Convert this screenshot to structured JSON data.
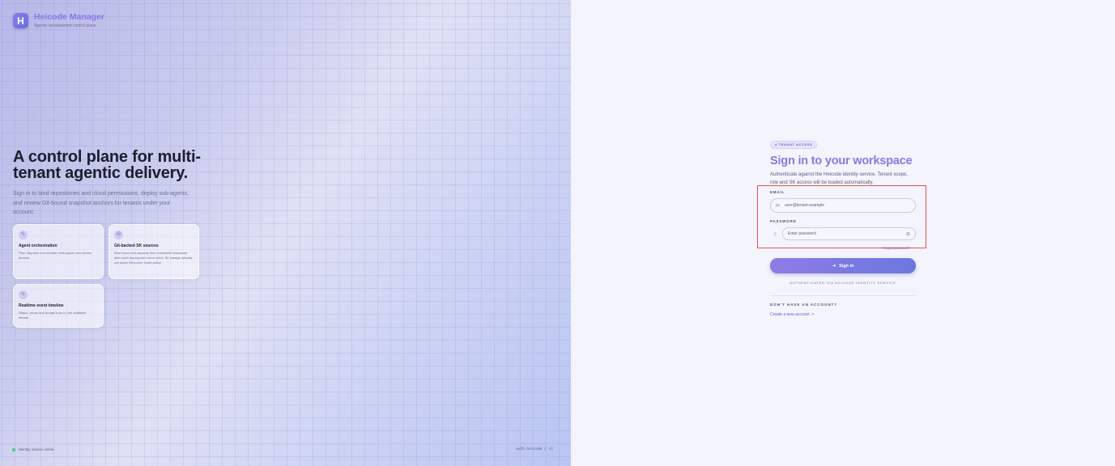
{
  "brand": {
    "logo_letter": "H",
    "name": "Heicode Manager",
    "tagline": "Agentic development control plane"
  },
  "hero": {
    "title": "A control plane for multi-tenant agentic delivery.",
    "description": "Sign in to bind repositories and cloud permissions, deploy sub-agents, and review Git-bound snapshot anchors for tenants under your account."
  },
  "features": [
    {
      "icon": "link-icon",
      "glyph": "✎",
      "title": "Agent orchestration",
      "description": "Plan, dispatch and monitor multi-agent runs across tenants."
    },
    {
      "icon": "database-icon",
      "glyph": "⛁",
      "title": "Git-backed SK sources",
      "description": "Bind repos and capacity first; immutable snapshots after each deployment show which SK lineage actually ran under Resource Grant policy."
    },
    {
      "icon": "activity-icon",
      "glyph": "∿",
      "title": "Realtime event timeline",
      "description": "Status, errors and budget burn in one auditable stream."
    }
  ],
  "footer": {
    "status": "Identity service online",
    "version": "auth.heicode / v1"
  },
  "form": {
    "badge": "● TENANT ACCESS",
    "title": "Sign in to your workspace",
    "description": "Authenticate against the Heicode identity service. Tenant scope, role and SK access will be loaded automatically.",
    "email": {
      "label": "EMAIL",
      "placeholder": "user@tenant.example",
      "value": ""
    },
    "password": {
      "label": "PASSWORD",
      "placeholder": "Enter password",
      "value": ""
    },
    "forgot_link": "Forgot password?",
    "submit_label": "Sign in",
    "auth_note": "AUTHENTICATED VIA HEICODE IDENTITY SERVICE",
    "no_account_label": "DON'T HAVE AN ACCOUNT?",
    "create_account_link": "Create a new account ↗"
  },
  "colors": {
    "accent": "#8a78e2",
    "highlight_box": "#e55050",
    "status_online": "#48c893"
  }
}
